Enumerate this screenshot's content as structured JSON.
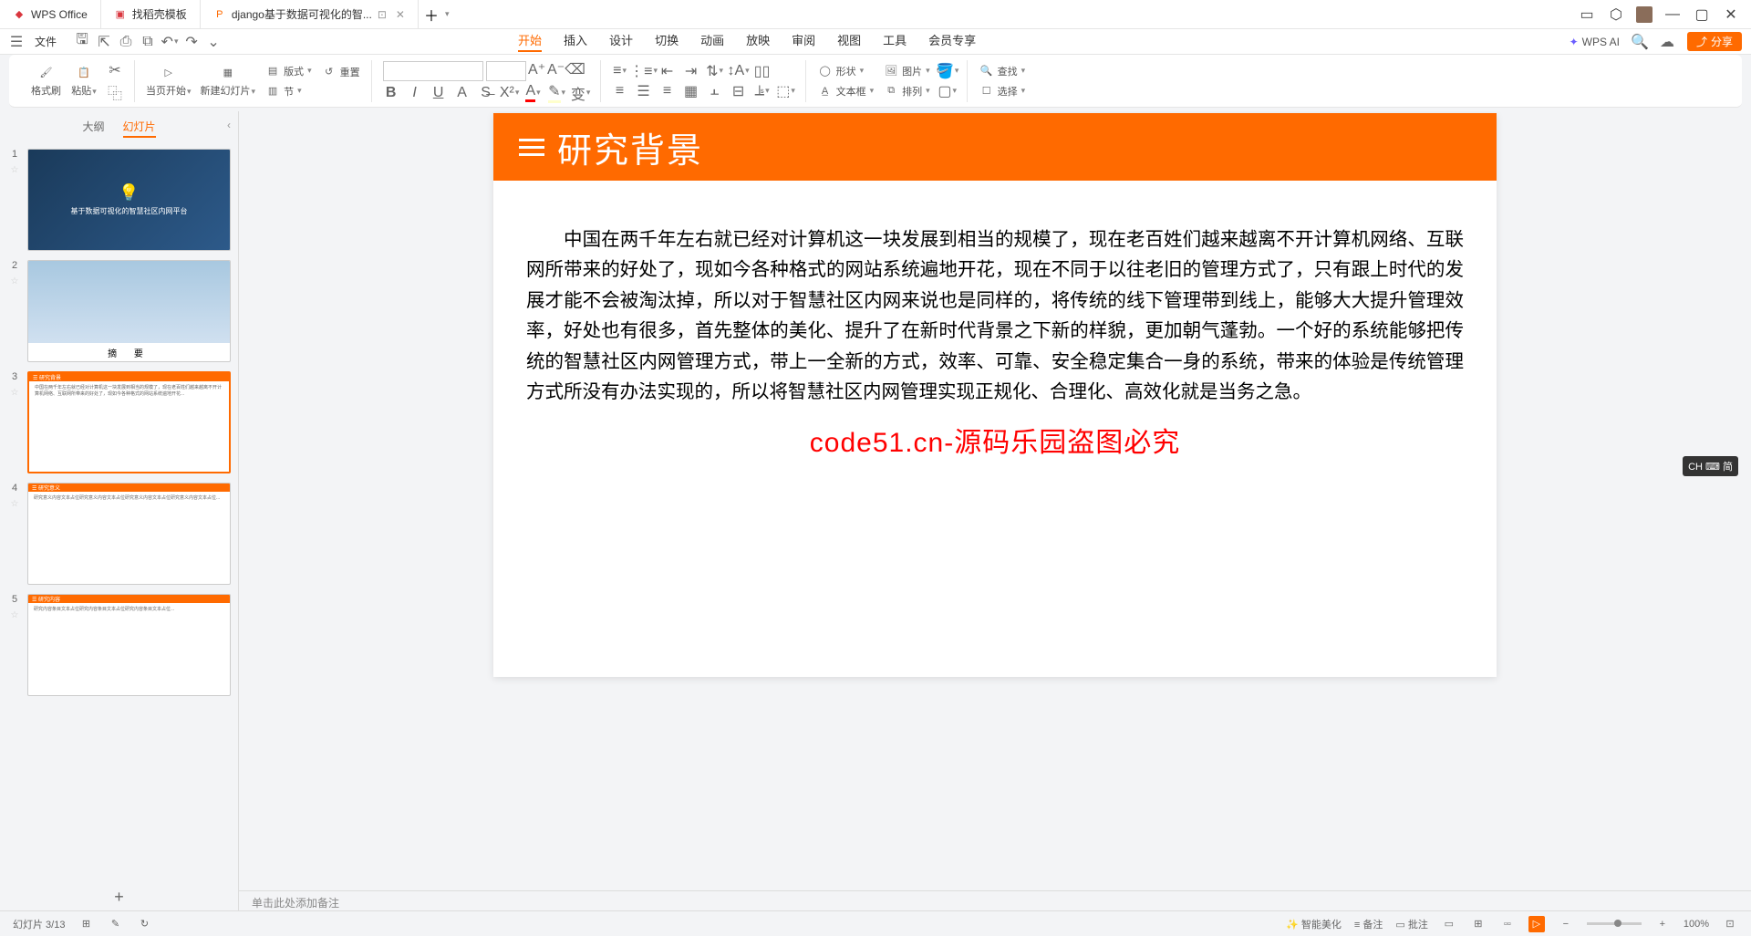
{
  "titlebar": {
    "tabs": [
      {
        "icon_color": "#d9363e",
        "label": "WPS Office"
      },
      {
        "icon_color": "#d9363e",
        "label": "找稻壳模板"
      },
      {
        "icon_color": "#ff6a00",
        "label": "django基于数据可视化的智..."
      }
    ]
  },
  "menubar": {
    "file_label": "文件",
    "tabs": [
      "开始",
      "插入",
      "设计",
      "切换",
      "动画",
      "放映",
      "审阅",
      "视图",
      "工具",
      "会员专享"
    ],
    "active_tab": "开始",
    "wps_ai": "WPS AI",
    "share": "分享"
  },
  "ribbon": {
    "format_painter": "格式刷",
    "paste": "粘贴",
    "start_from": "当页开始",
    "new_slide": "新建幻灯片",
    "layout": "版式",
    "section": "节",
    "reset": "重置",
    "shape": "形状",
    "image": "图片",
    "textbox": "文本框",
    "arrange": "排列",
    "find": "查找",
    "select": "选择"
  },
  "sidebar": {
    "tab_outline": "大纲",
    "tab_slides": "幻灯片",
    "slides": [
      {
        "num": "1",
        "kind": "title",
        "title": "基于数据可视化的智慧社区内网平台"
      },
      {
        "num": "2",
        "kind": "abstract",
        "footer": "摘 要"
      },
      {
        "num": "3",
        "kind": "content",
        "bar": "☰ 研究背景",
        "selected": true
      },
      {
        "num": "4",
        "kind": "content",
        "bar": "☰ 研究意义"
      },
      {
        "num": "5",
        "kind": "content",
        "bar": "☰ 研究内容"
      }
    ]
  },
  "canvas": {
    "title": "研究背景",
    "body": "中国在两千年左右就已经对计算机这一块发展到相当的规模了，现在老百姓们越来越离不开计算机网络、互联网所带来的好处了，现如今各种格式的网站系统遍地开花，现在不同于以往老旧的管理方式了，只有跟上时代的发展才能不会被淘汰掉，所以对于智慧社区内网来说也是同样的，将传统的线下管理带到线上，能够大大提升管理效率，好处也有很多，首先整体的美化、提升了在新时代背景之下新的样貌，更加朝气蓬勃。一个好的系统能够把传统的智慧社区内网管理方式，带上一全新的方式，效率、可靠、安全稳定集合一身的系统，带来的体验是传统管理方式所没有办法实现的，所以将智慧社区内网管理实现正规化、合理化、高效化就是当务之急。",
    "watermark": "code51.cn-源码乐园盗图必究"
  },
  "notes_placeholder": "单击此处添加备注",
  "ime": "CH ⌨ 简",
  "statusbar": {
    "left_items": [
      "幻灯片 3/13",
      "⊞",
      "✎",
      "↻"
    ],
    "right_items": [
      "智能美化",
      "备注",
      "批注"
    ],
    "zoom": "100%"
  }
}
